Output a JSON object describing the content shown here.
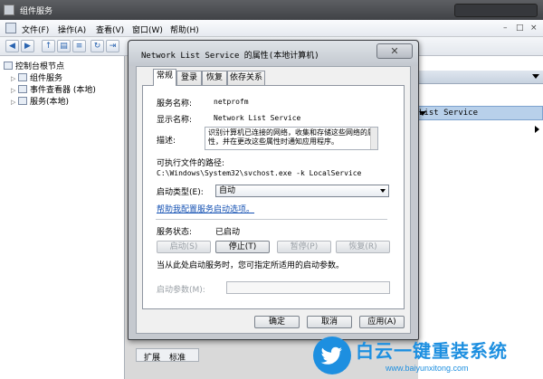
{
  "window": {
    "title": "组件服务"
  },
  "menu": {
    "items": [
      "文件(F)",
      "操作(A)",
      "查看(V)",
      "窗口(W)",
      "帮助(H)"
    ],
    "controls": [
      "–",
      "□",
      "×"
    ]
  },
  "toolbar": {
    "icons": [
      "back-icon",
      "forward-icon",
      "up-icon",
      "show-hide-tree-icon",
      "properties-icon",
      "refresh-icon",
      "export-icon",
      "help-icon",
      "view-icon"
    ]
  },
  "tree": {
    "items": [
      {
        "label": "控制台根节点",
        "expander": ""
      },
      {
        "label": "组件服务",
        "expander": "▷"
      },
      {
        "label": "事件查看器 (本地)",
        "expander": "▷"
      },
      {
        "label": "服务(本地)",
        "expander": "▷"
      }
    ]
  },
  "actions": {
    "selected": "List Service"
  },
  "bottom_tabs": [
    "扩展",
    "标准"
  ],
  "dialog": {
    "title": "Network List Service 的属性(本地计算机)",
    "close": "✕",
    "tabs": [
      "常规",
      "登录",
      "恢复",
      "依存关系"
    ],
    "service_name_label": "服务名称:",
    "service_name": "netprofm",
    "display_name_label": "显示名称:",
    "display_name": "Network List Service",
    "description_label": "描述:",
    "description": "识别计算机已连接的网络，收集和存储这些网络的属性，并在更改这些属性时通知应用程序。",
    "path_label": "可执行文件的路径:",
    "path": "C:\\Windows\\System32\\svchost.exe -k LocalService",
    "startup_type_label": "启动类型(E):",
    "startup_type": "自动",
    "help_link": "帮助我配置服务启动选项。",
    "status_label": "服务状态:",
    "status": "已启动",
    "buttons": {
      "start": "启动(S)",
      "stop": "停止(T)",
      "pause": "暂停(P)",
      "resume": "恢复(R)"
    },
    "note": "当从此处启动服务时，您可指定所适用的启动参数。",
    "params_label": "启动参数(M):",
    "ok": "确定",
    "cancel": "取消",
    "apply": "应用(A)"
  },
  "watermark": {
    "title": "白云一键重装系统",
    "url": "www.baiyunxitong.com"
  }
}
